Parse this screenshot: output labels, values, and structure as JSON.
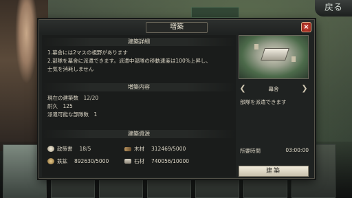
{
  "screen": {
    "back_label": "戻る"
  },
  "dialog": {
    "title": "増築",
    "close_glyph": "×",
    "sections": {
      "details_title": "建築詳細",
      "details_lines": [
        "1.幕舎には2マスの視野があります",
        "2.部隊を幕舎に派遣できます。派遣中部隊の移動速度は100%上昇し、",
        "士気を消耗しません"
      ],
      "content_title": "増築内容",
      "content_lines": [
        "現在の建築数　12/20",
        "耐久　125",
        "派遣可能な部隊数　1"
      ],
      "resources_title": "建築資源",
      "resources": [
        {
          "icon": "scroll-icon",
          "name": "政策書",
          "amount": "18/5"
        },
        {
          "icon": "lumber-icon",
          "name": "木材",
          "amount": "312469/5000"
        },
        {
          "icon": "ore-icon",
          "name": "鉄鉱",
          "amount": "892630/5000"
        },
        {
          "icon": "stone-icon",
          "name": "石材",
          "amount": "740056/10000"
        }
      ]
    },
    "building": {
      "name": "幕舎",
      "description": "部隊を派遣できます",
      "time_label": "所要時間",
      "time_value": "03:00:00",
      "build_label": "建築"
    },
    "colors": {
      "panel": "#1f2221",
      "accent_border": "#6b675a",
      "close_red": "#b4332a",
      "build_button": "#e6dfcc"
    }
  }
}
